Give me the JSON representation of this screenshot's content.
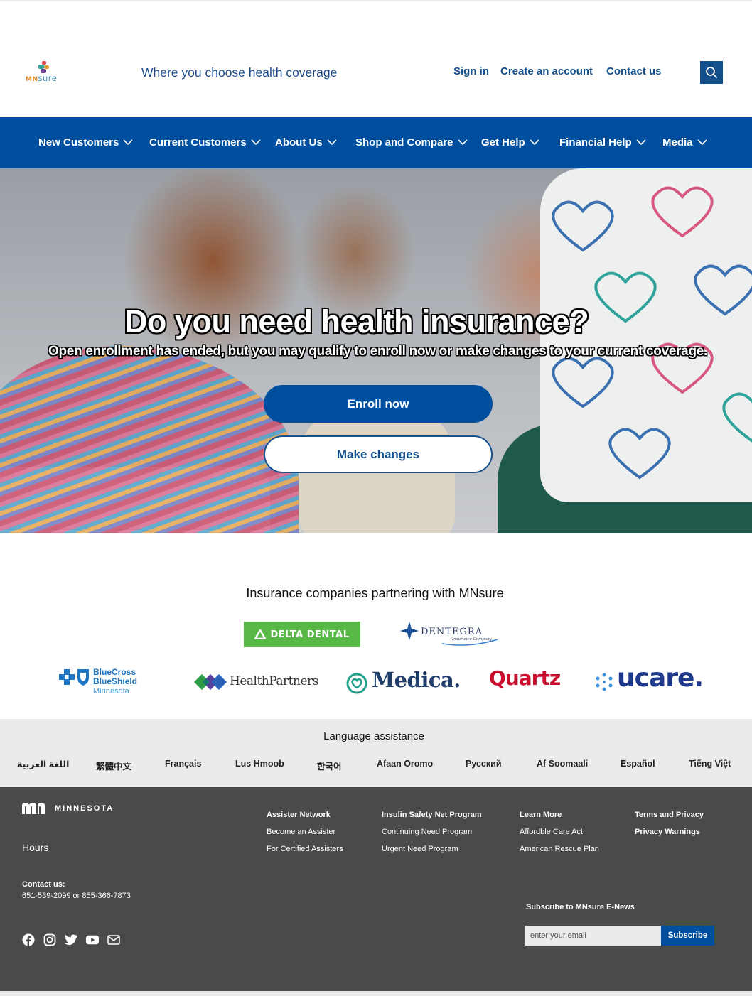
{
  "header": {
    "logo_text_mn": "MN",
    "logo_text_sure": "sure",
    "tagline": "Where you choose health coverage",
    "links": [
      "Sign in",
      "Create an account",
      "Contact us"
    ],
    "search_icon": "search-icon"
  },
  "nav": {
    "items": [
      "New Customers",
      "Current Customers",
      "About Us",
      "Shop and Compare",
      "Get Help",
      "Financial Help",
      "Media"
    ]
  },
  "hero": {
    "title": "Do you need health insurance?",
    "subtitle": "Open enrollment has ended, but you may qualify to enroll now or make changes to your current coverage.",
    "primary_button": "Enroll now",
    "secondary_button": "Make changes"
  },
  "partners": {
    "title": "Insurance companies partnering with MNsure",
    "logos": {
      "delta": "DELTA DENTAL",
      "dentegra": "DENTEGRA",
      "dentegra_sub": "Insurance Company",
      "bcbs_line1": "BlueCross",
      "bcbs_line2": "BlueShield",
      "bcbs_line3": "Minnesota",
      "healthpartners": "HealthPartners",
      "medica": "Medica.",
      "quartz": "Quartz",
      "ucare": "ucare."
    }
  },
  "language": {
    "title": "Language assistance",
    "items": [
      "اللغة العربية",
      "繁體中文",
      "Français",
      "Lus Hmoob",
      "한국어",
      "Afaan Oromo",
      "Русский",
      "Af Soomaali",
      "Español",
      "Tiếng Việt"
    ]
  },
  "footer": {
    "state_word": "MINNESOTA",
    "hours": "Hours",
    "contact_label": "Contact us:",
    "contact_phones": "651-539-2099 or 855-366-7873",
    "col1": {
      "head": "Assister Network",
      "links": [
        "Become an Assister",
        "For Certified Assisters"
      ]
    },
    "col2": {
      "head": "Insulin Safety Net Program",
      "links": [
        "Continuing Need Program",
        "Urgent Need Program"
      ]
    },
    "col3": {
      "head": "Learn More",
      "links": [
        "Affordble Care Act",
        "American Rescue Plan"
      ]
    },
    "col4": {
      "links": [
        "Terms and Privacy",
        "Privacy Warnings"
      ]
    },
    "social_icons": [
      "facebook-icon",
      "instagram-icon",
      "twitter-icon",
      "youtube-icon",
      "mail-icon"
    ],
    "subscribe_label": "Subscribe to MNsure E-News",
    "email_placeholder": "enter your email",
    "subscribe_button": "Subscribe"
  },
  "colors": {
    "brand_blue": "#004f9e",
    "link_blue": "#14508c",
    "footer_bg": "#4a4a4a",
    "lang_bg": "#ebebeb"
  }
}
